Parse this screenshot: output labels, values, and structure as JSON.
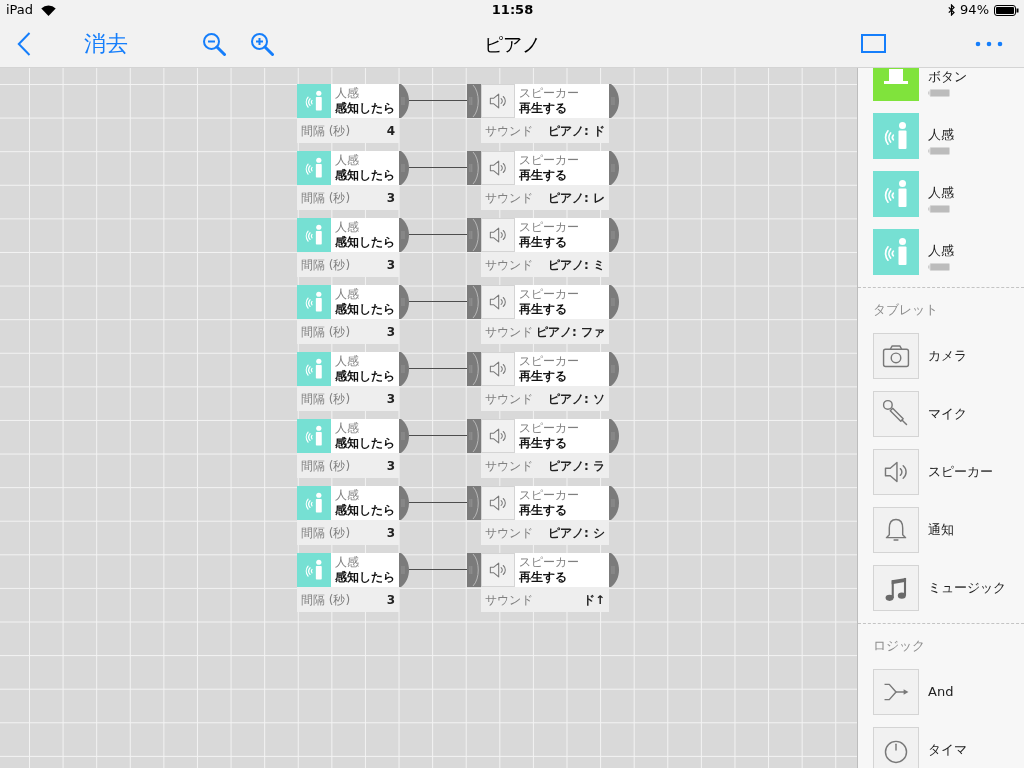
{
  "status_bar": {
    "device": "iPad",
    "time": "11:58",
    "battery": "94%"
  },
  "nav_bar": {
    "clear_button": "消去",
    "title": "ピアノ"
  },
  "canvas": {
    "rules": [
      {
        "trigger": {
          "kind": "motion",
          "category": "人感",
          "behavior": "感知したら",
          "param_label": "間隔 (秒)",
          "param_value": "4"
        },
        "output": {
          "kind": "speaker",
          "category": "スピーカー",
          "behavior": "再生する",
          "param_label": "サウンド",
          "param_value": "ピアノ: ド"
        }
      },
      {
        "trigger": {
          "kind": "motion",
          "category": "人感",
          "behavior": "感知したら",
          "param_label": "間隔 (秒)",
          "param_value": "3"
        },
        "output": {
          "kind": "speaker",
          "category": "スピーカー",
          "behavior": "再生する",
          "param_label": "サウンド",
          "param_value": "ピアノ: レ"
        }
      },
      {
        "trigger": {
          "kind": "motion",
          "category": "人感",
          "behavior": "感知したら",
          "param_label": "間隔 (秒)",
          "param_value": "3"
        },
        "output": {
          "kind": "speaker",
          "category": "スピーカー",
          "behavior": "再生する",
          "param_label": "サウンド",
          "param_value": "ピアノ: ミ"
        }
      },
      {
        "trigger": {
          "kind": "motion",
          "category": "人感",
          "behavior": "感知したら",
          "param_label": "間隔 (秒)",
          "param_value": "3"
        },
        "output": {
          "kind": "speaker",
          "category": "スピーカー",
          "behavior": "再生する",
          "param_label": "サウンド",
          "param_value": "ピアノ: ファ"
        }
      },
      {
        "trigger": {
          "kind": "motion",
          "category": "人感",
          "behavior": "感知したら",
          "param_label": "間隔 (秒)",
          "param_value": "3"
        },
        "output": {
          "kind": "speaker",
          "category": "スピーカー",
          "behavior": "再生する",
          "param_label": "サウンド",
          "param_value": "ピアノ: ソ"
        }
      },
      {
        "trigger": {
          "kind": "motion",
          "category": "人感",
          "behavior": "感知したら",
          "param_label": "間隔 (秒)",
          "param_value": "3"
        },
        "output": {
          "kind": "speaker",
          "category": "スピーカー",
          "behavior": "再生する",
          "param_label": "サウンド",
          "param_value": "ピアノ: ラ"
        }
      },
      {
        "trigger": {
          "kind": "motion",
          "category": "人感",
          "behavior": "感知したら",
          "param_label": "間隔 (秒)",
          "param_value": "3"
        },
        "output": {
          "kind": "speaker",
          "category": "スピーカー",
          "behavior": "再生する",
          "param_label": "サウンド",
          "param_value": "ピアノ: シ"
        }
      },
      {
        "trigger": {
          "kind": "motion",
          "category": "人感",
          "behavior": "感知したら",
          "param_label": "間隔 (秒)",
          "param_value": "3"
        },
        "output": {
          "kind": "speaker",
          "category": "スピーカー",
          "behavior": "再生する",
          "param_label": "サウンド",
          "param_value": "ド↑"
        }
      }
    ]
  },
  "palette": {
    "sections": [
      {
        "items": [
          {
            "kind": "button",
            "label": "ボタン"
          },
          {
            "kind": "motion",
            "label": "人感"
          },
          {
            "kind": "motion",
            "label": "人感"
          },
          {
            "kind": "motion",
            "label": "人感"
          }
        ]
      },
      {
        "header": "タブレット",
        "items": [
          {
            "kind": "camera",
            "label": "カメラ"
          },
          {
            "kind": "mic",
            "label": "マイク"
          },
          {
            "kind": "speaker",
            "label": "スピーカー"
          },
          {
            "kind": "notification",
            "label": "通知"
          },
          {
            "kind": "music",
            "label": "ミュージック"
          }
        ]
      },
      {
        "header": "ロジック",
        "items": [
          {
            "kind": "and",
            "label": "And"
          },
          {
            "kind": "timer",
            "label": "タイマ"
          }
        ]
      }
    ]
  }
}
